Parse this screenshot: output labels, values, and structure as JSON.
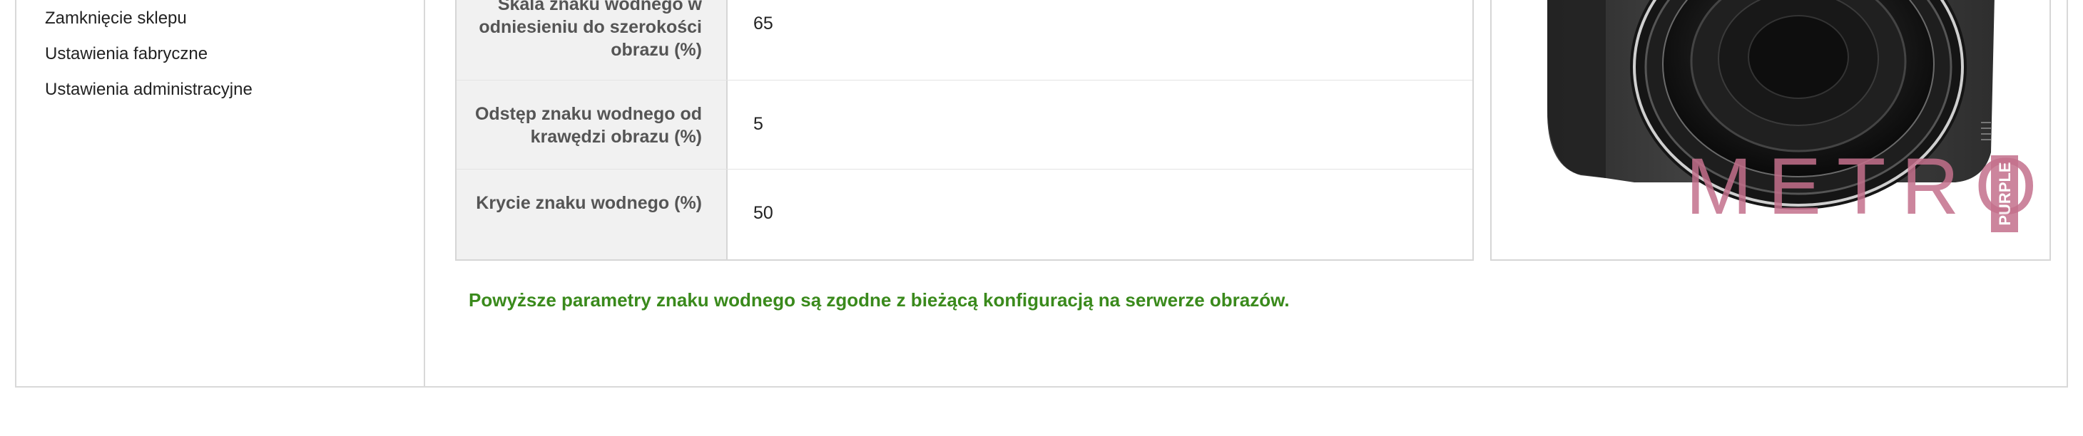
{
  "sidebar": {
    "items": [
      {
        "label": "Zamknięcie sklepu"
      },
      {
        "label": "Ustawienia fabryczne"
      },
      {
        "label": "Ustawienia administracyjne"
      }
    ]
  },
  "watermark_settings": {
    "rows": [
      {
        "label": "Skala znaku wodnego w odniesieniu do szerokości obrazu (%)",
        "value": "65"
      },
      {
        "label": "Odstęp znaku wodnego od krawędzi obrazu (%)",
        "value": "5"
      },
      {
        "label": "Krycie znaku wodnego (%)",
        "value": "50"
      }
    ]
  },
  "preview": {
    "watermark_text": "METRO",
    "watermark_tag": "PURPLE",
    "watermark_color": "#c4708c"
  },
  "status": {
    "message": "Powyższe parametry znaku wodnego są zgodne z bieżącą konfiguracją na serwerze obrazów.",
    "color": "#3a8a1c"
  }
}
